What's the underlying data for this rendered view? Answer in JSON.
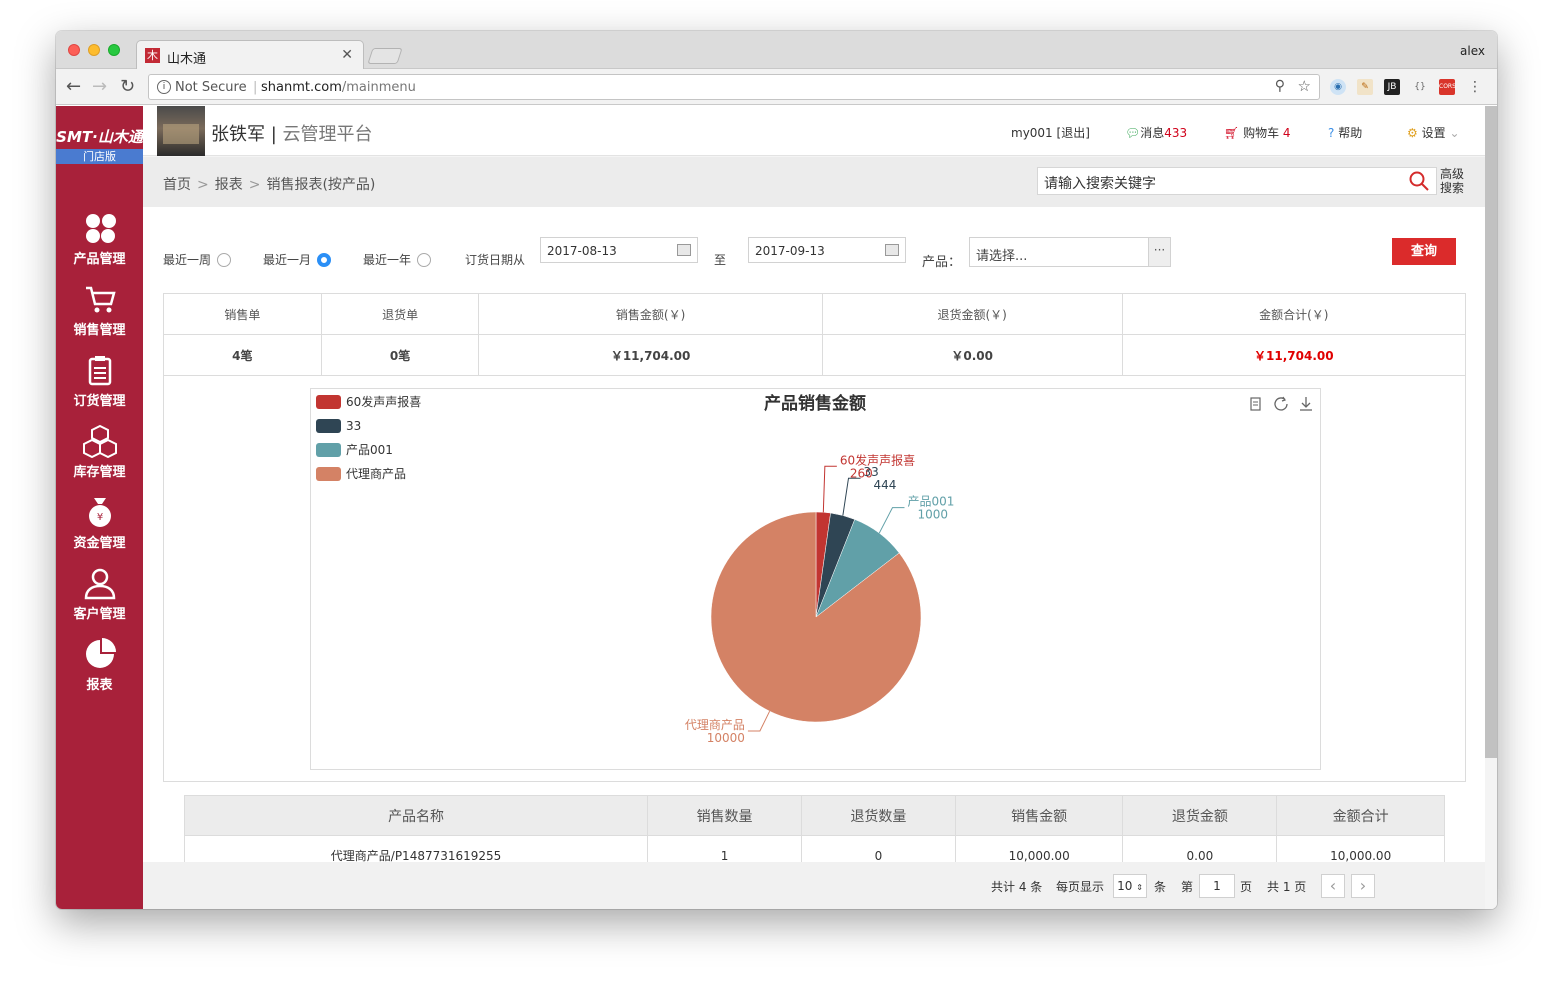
{
  "browser": {
    "tab_title": "山木通",
    "tab_favicon": "木",
    "profile": "alex",
    "security": "Not Secure",
    "url_host": "shanmt.com",
    "url_path": "/mainmenu"
  },
  "sidebar": {
    "logo": "SMT·山木通",
    "edition": "门店版",
    "items": [
      {
        "label": "产品管理",
        "icon": "product-icon"
      },
      {
        "label": "销售管理",
        "icon": "cart-icon"
      },
      {
        "label": "订货管理",
        "icon": "clipboard-icon"
      },
      {
        "label": "库存管理",
        "icon": "boxes-icon"
      },
      {
        "label": "资金管理",
        "icon": "money-bag-icon"
      },
      {
        "label": "客户管理",
        "icon": "user-icon"
      },
      {
        "label": "报表",
        "icon": "pie-chart-icon"
      }
    ]
  },
  "header": {
    "brand_name": "张铁军",
    "brand_sep": "|",
    "brand_sub": "云管理平台",
    "user": "my001",
    "logout": "[退出]",
    "messages_label": "消息",
    "messages_count": "433",
    "cart_label": "购物车",
    "cart_count": "4",
    "help": "帮助",
    "settings": "设置"
  },
  "breadcrumb": [
    "首页",
    "报表",
    "销售报表(按产品)"
  ],
  "search": {
    "placeholder": "请输入搜索关键字",
    "advanced_line1": "高级",
    "advanced_line2": "搜索"
  },
  "filters": {
    "week": "最近一周",
    "month": "最近一月",
    "year": "最近一年",
    "selected": "month",
    "date_from_label": "订货日期从",
    "date_from": "2017-08-13",
    "to_label": "至",
    "date_to": "2017-09-13",
    "product_label": "产品：",
    "product_placeholder": "请选择...",
    "query_button": "查询"
  },
  "summary": {
    "headers": [
      "销售单",
      "退货单",
      "销售金额(￥)",
      "退货金额(￥)",
      "金额合计(￥)"
    ],
    "values": [
      "4笔",
      "0笔",
      "￥11,704.00",
      "￥0.00",
      "￥11,704.00"
    ]
  },
  "chart_data": {
    "type": "pie",
    "title": "产品销售金额",
    "legend_position": "top-left",
    "slices": [
      {
        "name": "60发声声报喜",
        "value": 260,
        "color": "#c23531"
      },
      {
        "name": "33",
        "value": 444,
        "color": "#2f4554"
      },
      {
        "name": "产品001",
        "value": 1000,
        "color": "#61a0a8"
      },
      {
        "name": "代理商产品",
        "value": 10000,
        "color": "#d48265"
      }
    ],
    "toolbox": [
      "data-view-icon",
      "restore-icon",
      "download-icon"
    ]
  },
  "detail": {
    "headers": [
      "产品名称",
      "销售数量",
      "退货数量",
      "销售金额",
      "退货金额",
      "金额合计"
    ],
    "rows": [
      [
        "代理商产品/P1487731619255",
        "1",
        "0",
        "10,000.00",
        "0.00",
        "10,000.00"
      ]
    ]
  },
  "pagination": {
    "total": "共计 4 条",
    "per_page_label": "每页显示",
    "per_page": "10",
    "unit": "条",
    "page_prefix": "第",
    "page": "1",
    "page_suffix": "页",
    "pages_total": "共 1 页",
    "prev": "‹",
    "next": "›"
  }
}
